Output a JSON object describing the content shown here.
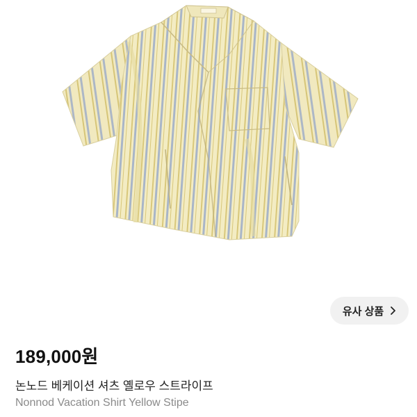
{
  "product": {
    "image_alt": "yellow striped vacation shirt",
    "price": "189,000원",
    "title_ko": "논노드 베케이션 셔츠 옐로우 스트라이프",
    "title_en": "Nonnod Vacation Shirt Yellow Stipe"
  },
  "similar": {
    "label": "유사 상품",
    "icon": "chevron-right-icon"
  },
  "colors": {
    "shirt_base": "#f3ecc3",
    "stripe": "#8fa3c9",
    "stripe_accent": "#d8c77a"
  }
}
